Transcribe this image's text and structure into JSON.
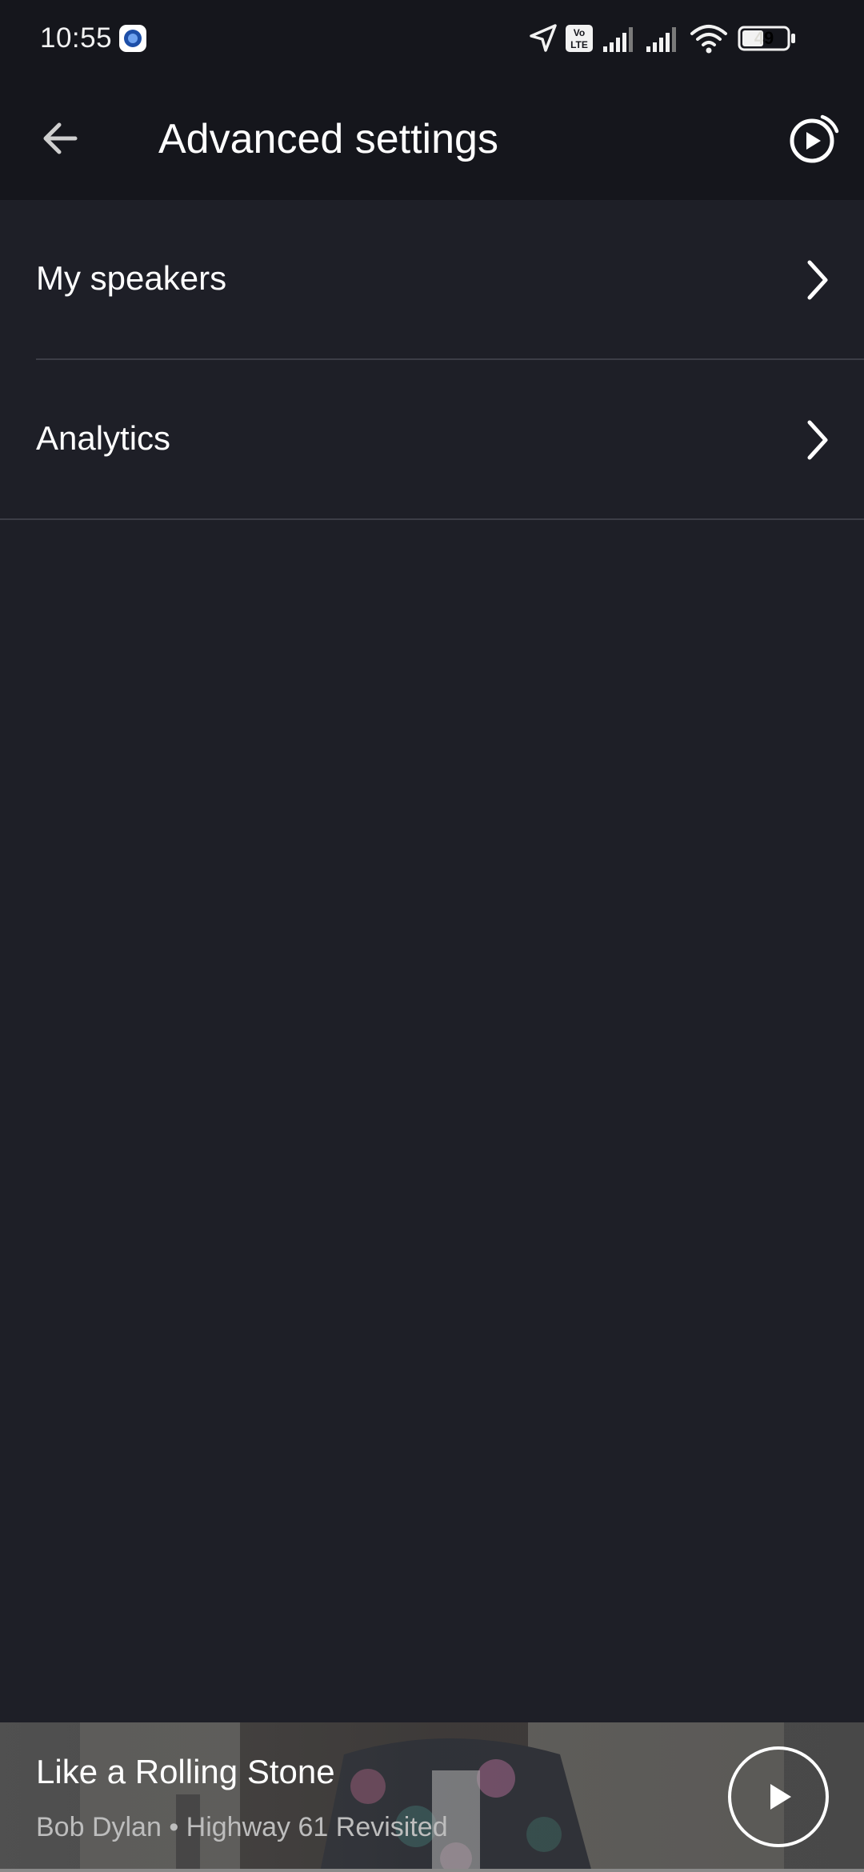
{
  "status_bar": {
    "time": "10:55",
    "battery": "49",
    "icons": [
      "app-notification-icon",
      "location-icon",
      "volte-icon",
      "signal-icon",
      "signal-icon",
      "wifi-icon",
      "battery-icon"
    ]
  },
  "app_bar": {
    "title": "Advanced settings",
    "back_icon": "arrow-left-icon",
    "action_icon": "now-playing-icon"
  },
  "settings": {
    "items": [
      {
        "label": "My speakers"
      },
      {
        "label": "Analytics"
      }
    ]
  },
  "mini_player": {
    "title": "Like a Rolling Stone",
    "subtitle": "Bob Dylan • Highway 61 Revisited",
    "play_icon": "play-icon"
  },
  "colors": {
    "background": "#1e1f27",
    "app_bar": "#15161c",
    "divider": "#3c3d46",
    "text_primary": "#ffffff",
    "text_secondary": "#bdbdbd"
  }
}
